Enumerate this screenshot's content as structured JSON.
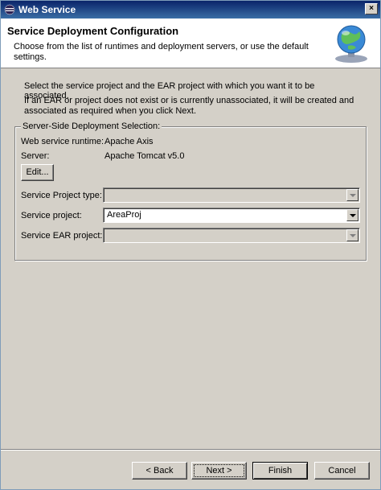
{
  "window": {
    "title": "Web Service",
    "close_glyph": "×"
  },
  "banner": {
    "title": "Service Deployment Configuration",
    "description": "Choose from the list of runtimes and deployment servers, or use the default settings.",
    "icon": "globe-service-icon"
  },
  "intro": {
    "line1": "Select the service project and the EAR project with which you want it to be associated.",
    "line2": "If an EAR or project does not exist or is currently unassociated, it will be created and associated as required when you click Next."
  },
  "deployment": {
    "legend": "Server-Side Deployment Selection:",
    "runtime_label": "Web service runtime:",
    "runtime_value": "Apache Axis",
    "server_label": "Server:",
    "server_value": "Apache Tomcat v5.0",
    "edit_button": "Edit...",
    "project_type_label": "Service Project type:",
    "project_type_value": "",
    "project_label": "Service project:",
    "project_value": "AreaProj",
    "ear_label": "Service EAR project:",
    "ear_value": ""
  },
  "buttons": {
    "back": "< Back",
    "next": "Next >",
    "finish": "Finish",
    "cancel": "Cancel"
  },
  "colors": {
    "titlebar_start": "#0a246a",
    "titlebar_end": "#3a6ea5",
    "dialog_bg": "#d4d0c8",
    "banner_bg": "#ffffff"
  }
}
